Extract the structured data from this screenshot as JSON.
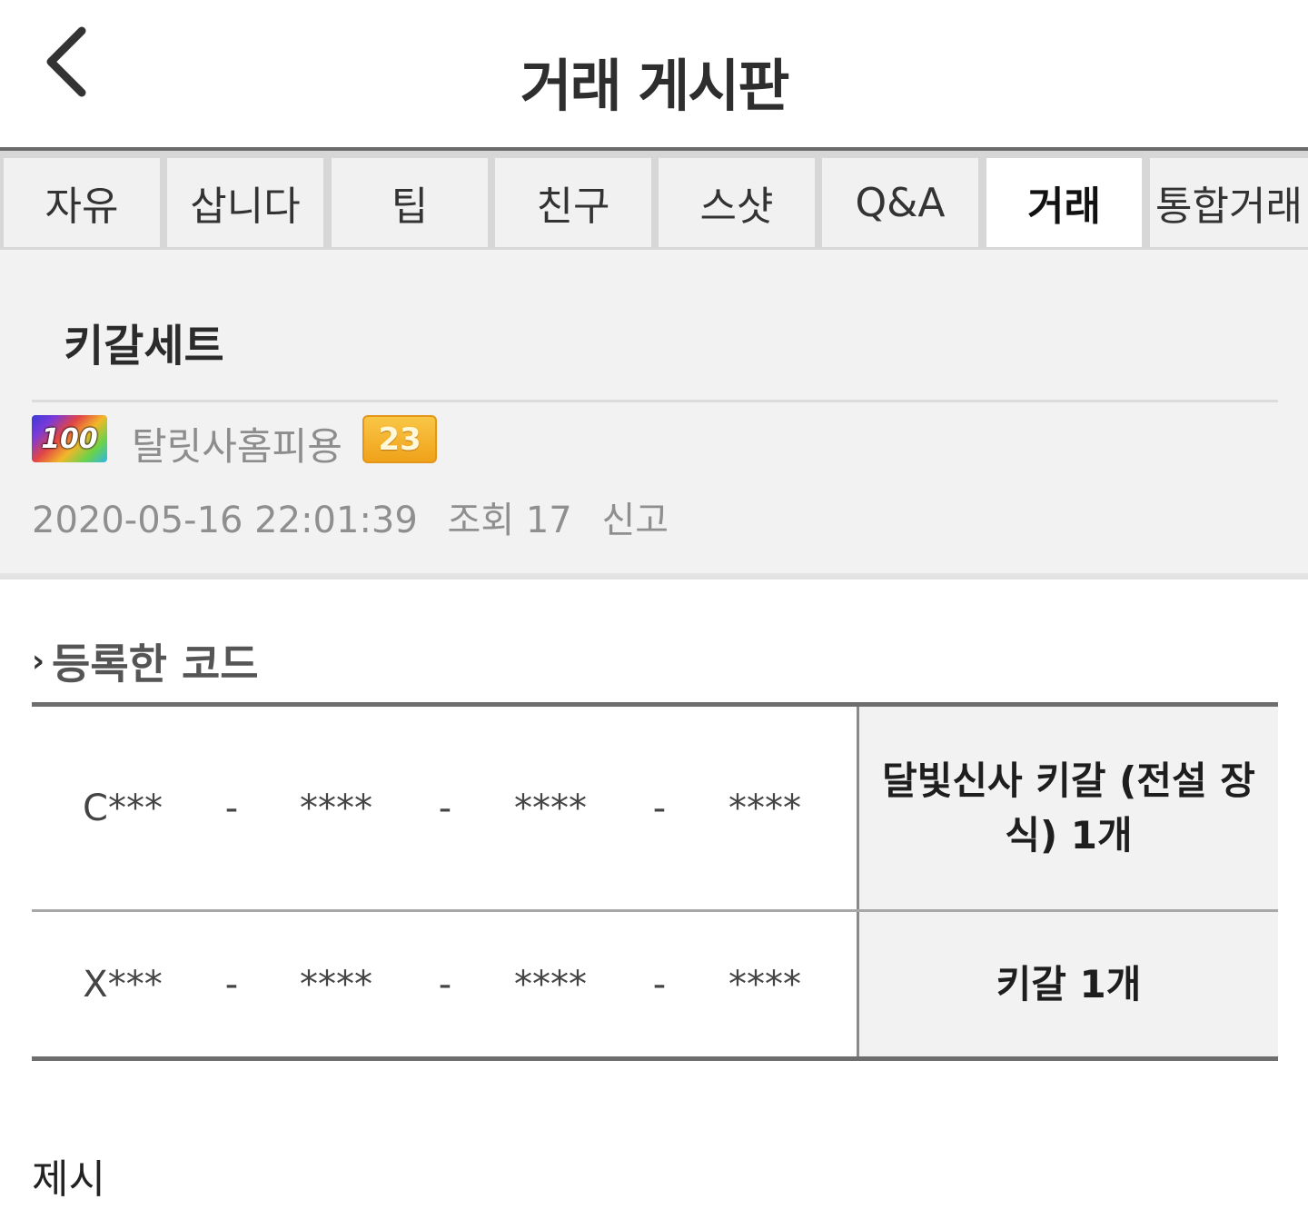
{
  "header": {
    "title": "거래 게시판",
    "back_icon": "chevron-left-icon"
  },
  "tabs": [
    {
      "label": "자유",
      "active": false
    },
    {
      "label": "삽니다",
      "active": false
    },
    {
      "label": "팁",
      "active": false
    },
    {
      "label": "친구",
      "active": false
    },
    {
      "label": "스샷",
      "active": false
    },
    {
      "label": "Q&A",
      "active": false
    },
    {
      "label": "거래",
      "active": true
    },
    {
      "label": "통합거래",
      "active": false
    }
  ],
  "post": {
    "title": "키갈세트",
    "rank_badge": "100",
    "author": "탈릿사홈피용",
    "level": "23",
    "datetime": "2020-05-16 22:01:39",
    "views": "조회 17",
    "report": "신고"
  },
  "codes": {
    "heading": "등록한 코드",
    "rows": [
      {
        "parts": [
          "C***",
          "-",
          "****",
          "-",
          "****",
          "-",
          "****"
        ],
        "item": "달빛신사 키갈 (전설 장식) 1개"
      },
      {
        "parts": [
          "X***",
          "-",
          "****",
          "-",
          "****",
          "-",
          "****"
        ],
        "item": "키갈 1개"
      }
    ]
  },
  "footer": {
    "text": "제시"
  },
  "colors": {
    "level_badge": "#f5b22a",
    "tab_active_bg": "#ffffff",
    "tab_bg": "#f1f1f1",
    "info_bg": "#f2f2f2"
  }
}
